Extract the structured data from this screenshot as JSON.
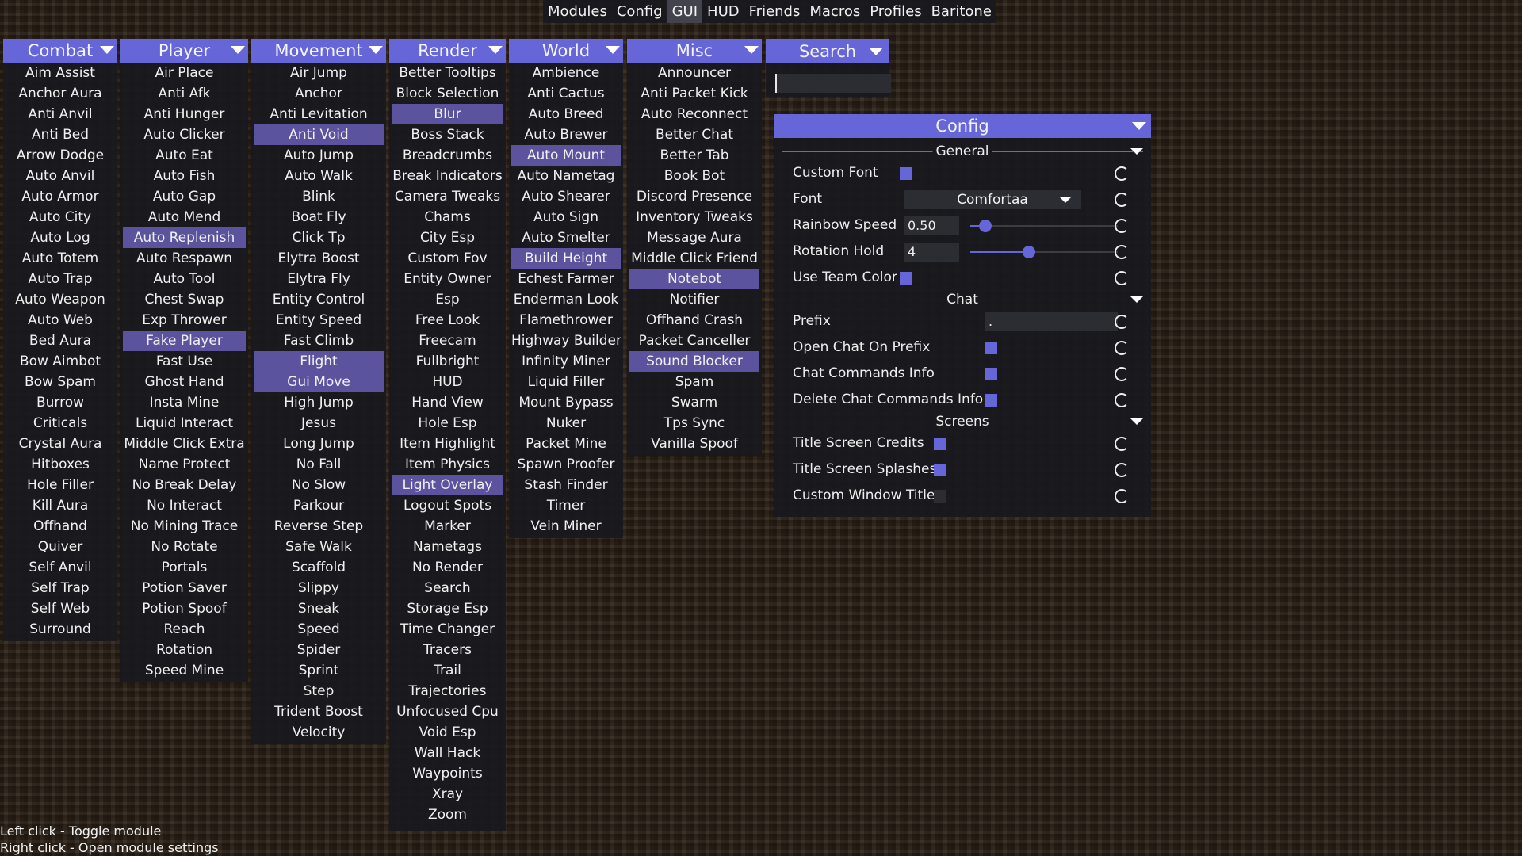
{
  "topbar": {
    "tabs": [
      "Modules",
      "Config",
      "GUI",
      "HUD",
      "Friends",
      "Macros",
      "Profiles",
      "Baritone"
    ],
    "active": "GUI"
  },
  "columns": [
    {
      "title": "Combat",
      "items": [
        "Aim Assist",
        "Anchor Aura",
        "Anti Anvil",
        "Anti Bed",
        "Arrow Dodge",
        "Auto Anvil",
        "Auto Armor",
        "Auto City",
        "Auto Log",
        "Auto Totem",
        "Auto Trap",
        "Auto Weapon",
        "Auto Web",
        "Bed Aura",
        "Bow Aimbot",
        "Bow Spam",
        "Burrow",
        "Criticals",
        "Crystal Aura",
        "Hitboxes",
        "Hole Filler",
        "Kill Aura",
        "Offhand",
        "Quiver",
        "Self Anvil",
        "Self Trap",
        "Self Web",
        "Surround"
      ],
      "active": []
    },
    {
      "title": "Player",
      "items": [
        "Air Place",
        "Anti Afk",
        "Anti Hunger",
        "Auto Clicker",
        "Auto Eat",
        "Auto Fish",
        "Auto Gap",
        "Auto Mend",
        "Auto Replenish",
        "Auto Respawn",
        "Auto Tool",
        "Chest Swap",
        "Exp Thrower",
        "Fake Player",
        "Fast Use",
        "Ghost Hand",
        "Insta Mine",
        "Liquid Interact",
        "Middle Click Extra",
        "Name Protect",
        "No Break Delay",
        "No Interact",
        "No Mining Trace",
        "No Rotate",
        "Portals",
        "Potion Saver",
        "Potion Spoof",
        "Reach",
        "Rotation",
        "Speed Mine"
      ],
      "active": [
        "Auto Replenish",
        "Fake Player"
      ]
    },
    {
      "title": "Movement",
      "items": [
        "Air Jump",
        "Anchor",
        "Anti Levitation",
        "Anti Void",
        "Auto Jump",
        "Auto Walk",
        "Blink",
        "Boat Fly",
        "Click Tp",
        "Elytra Boost",
        "Elytra Fly",
        "Entity Control",
        "Entity Speed",
        "Fast Climb",
        "Flight",
        "Gui Move",
        "High Jump",
        "Jesus",
        "Long Jump",
        "No Fall",
        "No Slow",
        "Parkour",
        "Reverse Step",
        "Safe Walk",
        "Scaffold",
        "Slippy",
        "Sneak",
        "Speed",
        "Spider",
        "Sprint",
        "Step",
        "Trident Boost",
        "Velocity"
      ],
      "active": [
        "Anti Void",
        "Flight",
        "Gui Move"
      ]
    },
    {
      "title": "Render",
      "items": [
        "Better Tooltips",
        "Block Selection",
        "Blur",
        "Boss Stack",
        "Breadcrumbs",
        "Break Indicators",
        "Camera Tweaks",
        "Chams",
        "City Esp",
        "Custom Fov",
        "Entity Owner",
        "Esp",
        "Free Look",
        "Freecam",
        "Fullbright",
        "HUD",
        "Hand View",
        "Hole Esp",
        "Item Highlight",
        "Item Physics",
        "Light Overlay",
        "Logout Spots",
        "Marker",
        "Nametags",
        "No Render",
        "Search",
        "Storage Esp",
        "Time Changer",
        "Tracers",
        "Trail",
        "Trajectories",
        "Unfocused Cpu",
        "Void Esp",
        "Wall Hack",
        "Waypoints",
        "Xray",
        "Zoom"
      ],
      "active": [
        "Blur",
        "Light Overlay"
      ]
    },
    {
      "title": "World",
      "items": [
        "Ambience",
        "Anti Cactus",
        "Auto Breed",
        "Auto Brewer",
        "Auto Mount",
        "Auto Nametag",
        "Auto Shearer",
        "Auto Sign",
        "Auto Smelter",
        "Build Height",
        "Echest Farmer",
        "Enderman Look",
        "Flamethrower",
        "Highway Builder",
        "Infinity Miner",
        "Liquid Filler",
        "Mount Bypass",
        "Nuker",
        "Packet Mine",
        "Spawn Proofer",
        "Stash Finder",
        "Timer",
        "Vein Miner"
      ],
      "active": [
        "Auto Mount",
        "Build Height"
      ]
    },
    {
      "title": "Misc",
      "items": [
        "Announcer",
        "Anti Packet Kick",
        "Auto Reconnect",
        "Better Chat",
        "Better Tab",
        "Book Bot",
        "Discord Presence",
        "Inventory Tweaks",
        "Message Aura",
        "Middle Click Friend",
        "Notebot",
        "Notifier",
        "Offhand Crash",
        "Packet Canceller",
        "Sound Blocker",
        "Spam",
        "Swarm",
        "Tps Sync",
        "Vanilla Spoof"
      ],
      "active": [
        "Notebot",
        "Sound Blocker"
      ]
    }
  ],
  "search": {
    "title": "Search",
    "value": ""
  },
  "config": {
    "title": "Config",
    "sections": {
      "general": "General",
      "chat": "Chat",
      "screens": "Screens"
    },
    "custom_font": {
      "label": "Custom Font",
      "checked": true
    },
    "font": {
      "label": "Font",
      "value": "Comfortaa"
    },
    "rainbow_speed": {
      "label": "Rainbow Speed",
      "value": "0.50",
      "fraction": 0.1
    },
    "rotation_hold": {
      "label": "Rotation Hold",
      "value": "4",
      "fraction": 0.4
    },
    "use_team_color": {
      "label": "Use Team Color",
      "checked": true
    },
    "prefix": {
      "label": "Prefix",
      "value": "."
    },
    "open_chat_on_prefix": {
      "label": "Open Chat On Prefix",
      "checked": true
    },
    "chat_commands_info": {
      "label": "Chat Commands Info",
      "checked": true
    },
    "delete_chat_commands_info": {
      "label": "Delete Chat Commands Info",
      "checked": true
    },
    "title_screen_credits": {
      "label": "Title Screen Credits",
      "checked": true
    },
    "title_screen_splashes": {
      "label": "Title Screen Splashes",
      "checked": true
    },
    "custom_window_title": {
      "label": "Custom Window Title",
      "checked": false
    }
  },
  "help": {
    "left": "Left click - Toggle module",
    "right": "Right click - Open module settings"
  },
  "colors": {
    "accent": "#6766d9",
    "active_item": "#5b539e",
    "panel": "#19191e"
  }
}
